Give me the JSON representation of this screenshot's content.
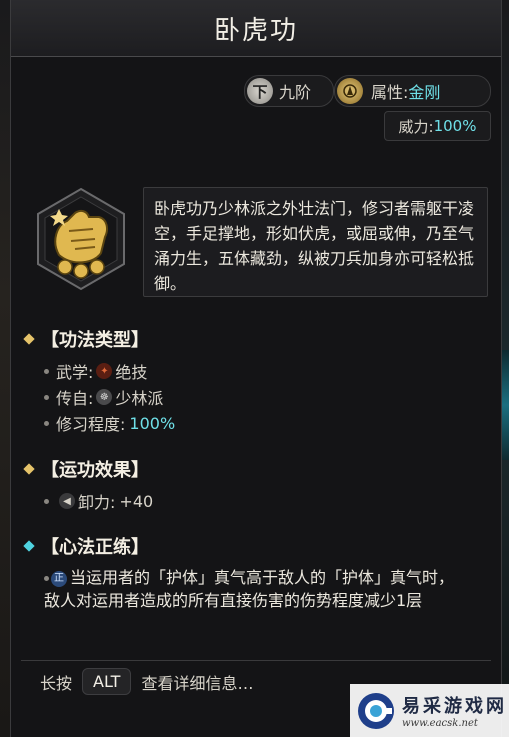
{
  "title": "卧虎功",
  "grade": {
    "icon": "下",
    "label": "九阶"
  },
  "attribute": {
    "label": "属性:",
    "value": "金刚",
    "icon": "attribute-emblem-icon"
  },
  "power": {
    "label": "威力:",
    "value": "100%"
  },
  "skill_icon": "tiger-fist-icon",
  "description": "卧虎功乃少林派之外壮法门，修习者需躯干凌空，手足撑地，形如伏虎，或屈或伸，乃至气涌力生，五体藏劲，纵被刀兵加身亦可轻松抵御。",
  "sections": {
    "type": {
      "heading": "【功法类型】",
      "rows": [
        {
          "label": "武学:",
          "value": "绝技",
          "icon": "martial-skill-icon"
        },
        {
          "label": "传自:",
          "value": "少林派",
          "icon": "shaolin-icon"
        },
        {
          "label": "修习程度:",
          "value": "100%"
        }
      ]
    },
    "effect": {
      "heading": "【运功效果】",
      "rows": [
        {
          "label": "卸力:",
          "value": "+40",
          "icon": "deflect-icon"
        }
      ]
    },
    "heart": {
      "heading": "【心法正练】",
      "icon_text": "正",
      "text": "当运用者的「护体」真气高于敌人的「护体」真气时，敌人对运用者造成的所有直接伤害的伤势程度减少1层"
    }
  },
  "footer": {
    "prefix": "长按",
    "key": "ALT",
    "suffix": "查看详细信息…"
  },
  "watermark": {
    "cn": "易采游戏网",
    "url": "www.eacsk.net"
  },
  "colors": {
    "accent_cyan": "#6fe0e8",
    "gold": "#e5c36a",
    "panel": "#141416"
  }
}
